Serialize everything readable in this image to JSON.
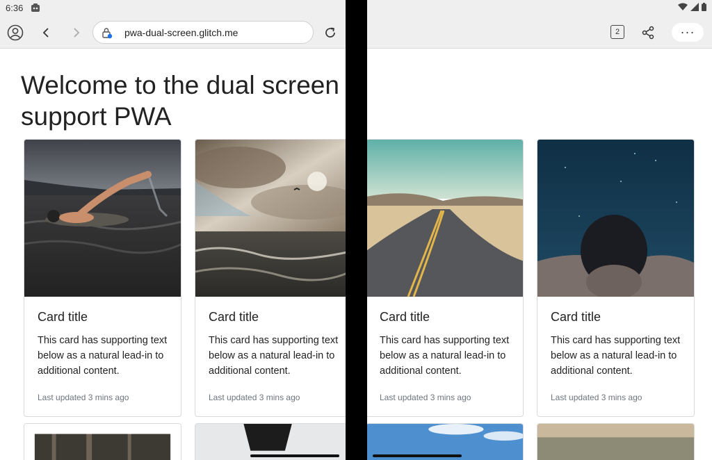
{
  "status": {
    "time": "6:36"
  },
  "browser": {
    "url": "pwa-dual-screen.glitch.me",
    "tab_count": "2",
    "menu_label": "···"
  },
  "page": {
    "title": "Welcome to the dual screen support PWA"
  },
  "cards": [
    {
      "title": "Card title",
      "text": "This card has supporting text below as a natural lead-in to additional content.",
      "meta": "Last updated 3 mins ago",
      "image": "swimmer"
    },
    {
      "title": "Card title",
      "text": "This card has supporting text below as a natural lead-in to additional content.",
      "meta": "Last updated 3 mins ago",
      "image": "sea-clouds"
    },
    {
      "title": "Card title",
      "text": "This card has supporting text below as a natural lead-in to additional content.",
      "meta": "Last updated 3 mins ago",
      "image": "desert-road"
    },
    {
      "title": "Card title",
      "text": "This card has supporting text below as a natural lead-in to additional content.",
      "meta": "Last updated 3 mins ago",
      "image": "underwater-person"
    }
  ],
  "icons": {
    "profile": "profile-icon",
    "back": "back-arrow-icon",
    "forward": "forward-arrow-icon",
    "lock": "site-security-icon",
    "reload": "reload-icon",
    "share": "share-icon",
    "wifi": "wifi-icon",
    "signal": "signal-icon",
    "battery": "battery-icon"
  },
  "colors": {
    "hinge": "#000000",
    "toolbar": "#efefef",
    "meta_text": "#6c757d"
  }
}
